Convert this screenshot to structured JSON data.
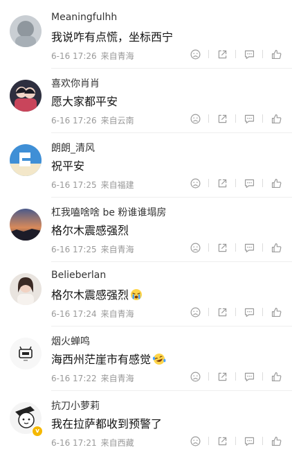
{
  "comments": [
    {
      "username": "Meaningfulhh",
      "text": "我说咋有点慌，坐标西宁",
      "date": "6-16 17:26",
      "location": "来自青海"
    },
    {
      "username": "喜欢你肖肖",
      "text": "愿大家都平安",
      "date": "6-16 17:26",
      "location": "来自云南"
    },
    {
      "username": "朗朗_清风",
      "text": "祝平安",
      "date": "6-16 17:25",
      "location": "来自福建"
    },
    {
      "username": "杠我嗑啥啥 be 粉谁谁塌房",
      "text": "格尔木震感强烈",
      "date": "6-16 17:25",
      "location": "来自青海"
    },
    {
      "username": "Belieberlan",
      "text": "格尔木震感强烈",
      "date": "6-16 17:24",
      "location": "来自青海",
      "emoji": "crying-emoji"
    },
    {
      "username": "烟火蝉鸣",
      "text": "海西州茫崖市有感觉",
      "date": "6-16 17:22",
      "location": "来自青海",
      "emoji": "laughing-tears-emoji"
    },
    {
      "username": "抗刀小萝莉",
      "text": "我在拉萨都收到预警了",
      "date": "6-16 17:21",
      "location": "来自西藏",
      "verified": true
    }
  ],
  "icons": [
    "dislike-icon",
    "share-icon",
    "comment-icon",
    "like-icon"
  ],
  "colors": {
    "username": "#333333",
    "text": "#111111",
    "meta": "#999999",
    "icon": "#9a9a9a",
    "verified_badge": "#f5b800"
  }
}
